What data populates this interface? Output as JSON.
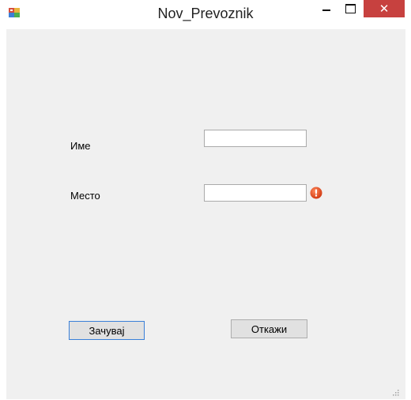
{
  "window": {
    "title": "Nov_Prevoznik",
    "close_glyph": "✕",
    "icons": {
      "app": "app-form-icon",
      "minimize": "minimize-icon",
      "maximize": "maximize-icon",
      "close": "close-icon"
    },
    "colors": {
      "close_button": "#c7413f",
      "client_background": "#f0f0f0",
      "default_button_border": "#3a80d8",
      "error_icon": "#e2491c"
    }
  },
  "form": {
    "fields": [
      {
        "label": "Име",
        "value": "",
        "has_error": false
      },
      {
        "label": "Место",
        "value": "",
        "has_error": true
      }
    ],
    "error_glyph": "!",
    "buttons": {
      "save_label": "Зачувај",
      "cancel_label": "Откажи"
    }
  }
}
